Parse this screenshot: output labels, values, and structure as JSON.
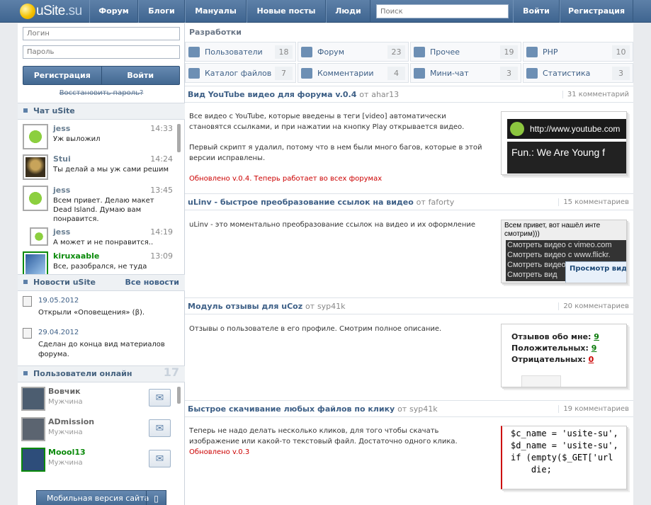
{
  "logo": {
    "main": "uSite",
    "suffix": ".su"
  },
  "nav": {
    "items": [
      "Форум",
      "Блоги",
      "Мануалы",
      "Новые посты",
      "Люди"
    ],
    "search_placeholder": "Поиск",
    "login": "Войти",
    "register": "Регистрация"
  },
  "auth": {
    "login_placeholder": "Логин",
    "password_placeholder": "Пароль",
    "register_btn": "Регистрация",
    "login_btn": "Войти",
    "restore": "Восстановить пароль?"
  },
  "chat": {
    "title": "Чат uSite",
    "messages": [
      {
        "name": "jess",
        "time": "14:33",
        "text": "Уж выложил"
      },
      {
        "name": "Stui",
        "time": "14:24",
        "text": "Ты делай а мы уж сами решим"
      },
      {
        "name": "jess",
        "time": "13:45",
        "text": "Всем привет. Делаю макет Dead Island. Думаю вам понравится."
      },
      {
        "name": "jess",
        "time": "14:19",
        "text": "А может и не понравится.."
      },
      {
        "name": "kiruxaable",
        "time": "13:09",
        "text": "Все, разобрался, не туда"
      }
    ]
  },
  "news": {
    "title": "Новости uSite",
    "all_link": "Все новости",
    "items": [
      {
        "date": "19.05.2012",
        "text": "Открыли «Оповещения» (β)."
      },
      {
        "date": "29.04.2012",
        "text": "Сделан до конца вид материалов форума."
      }
    ]
  },
  "online": {
    "title": "Пользователи онлайн",
    "count": "17",
    "users": [
      {
        "name": "Вовчик",
        "sex": "Мужчина"
      },
      {
        "name": "ADmission",
        "sex": "Мужчина"
      },
      {
        "name": "Moool13",
        "sex": "Мужчина"
      }
    ]
  },
  "mobile": "Мобильная версия сайта",
  "dev": {
    "title": "Разработки",
    "categories": [
      {
        "label": "Пользователи",
        "count": "18",
        "icon": "users-icon"
      },
      {
        "label": "Форум",
        "count": "23",
        "icon": "forum-icon"
      },
      {
        "label": "Прочее",
        "count": "19",
        "icon": "misc-icon"
      },
      {
        "label": "PHP",
        "count": "10",
        "icon": "php-icon"
      },
      {
        "label": "Каталог файлов",
        "count": "7",
        "icon": "files-icon"
      },
      {
        "label": "Комментарии",
        "count": "4",
        "icon": "comments-icon"
      },
      {
        "label": "Мини-чат",
        "count": "3",
        "icon": "minichat-icon"
      },
      {
        "label": "Статистика",
        "count": "3",
        "icon": "stats-icon"
      }
    ]
  },
  "posts": [
    {
      "title": "Вид YouTube видео для форума v.0.4",
      "by": "от",
      "author": "ahar13",
      "comments": "31 комментарий",
      "p1": "Все видео с YouTube, которые введены в теги [video] автоматически становятся ссылками, и при нажатии на кнопку Play открывается видео.",
      "p2": "Первый скрипт я удалил, потому что в нем были много багов, которые в этой версии исправлены.",
      "p3": "Обновлено v.0.4. Теперь работает во всех форумах",
      "thumb_url": "http://www.youtube.com",
      "thumb_title": "Fun.: We Are Young f"
    },
    {
      "title": "uLinv - быстрое преобразование ссылок на видео",
      "by": "от",
      "author": "faforty",
      "comments": "15 комментариев",
      "p1": "uLinv - это моментально преобразование ссылок на видео и их оформление",
      "thumb_text": "Всем привет, вот нашёл инте смотрим)))",
      "thumb_lines": [
        "Смотреть видео с vimeo.com",
        "Смотреть видео с www.flickr.",
        "Смотреть видео",
        "Смотреть вид"
      ],
      "thumb_popup": "Просмотр вид"
    },
    {
      "title": "Модуль отзывы для uCoz",
      "by": "от",
      "author": "syp41k",
      "comments": "20 комментариев",
      "p1": "Отзывы о пользователе в его профиле. Смотрим полное описание.",
      "rev_about": "Отзывов обо мне:",
      "rev_about_n": "9",
      "rev_pos": "Положительных:",
      "rev_pos_n": "9",
      "rev_neg": "Отрицательных:",
      "rev_neg_n": "0"
    },
    {
      "title": "Быстрое скачивание любых файлов по клику",
      "by": "от",
      "author": "syp41k",
      "comments": "19 комментариев",
      "p1": "Теперь не надо делать несколько кликов, для того чтобы скачать изображение или какой-то текстовый файл. Достаточно одного клика.",
      "p2": "Обновлено v.0.3",
      "code": [
        "$c_name = 'usite-su',",
        "$d_name = 'usite-su',",
        "if (empty($_GET['url",
        "    die;"
      ]
    }
  ]
}
